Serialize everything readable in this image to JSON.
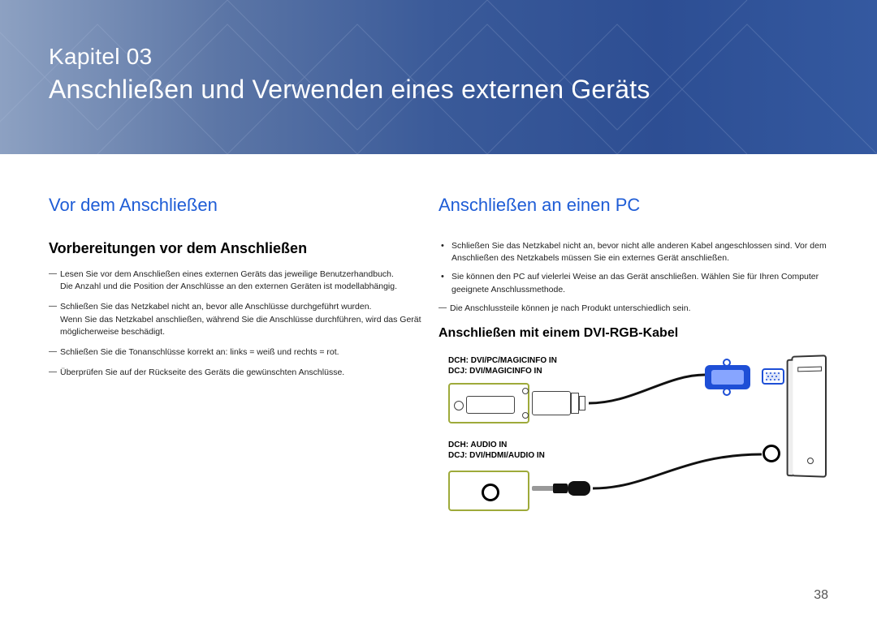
{
  "hero": {
    "chapter": "Kapitel 03",
    "title": "Anschließen und Verwenden eines externen Geräts"
  },
  "left": {
    "heading": "Vor dem Anschließen",
    "subheading": "Vorbereitungen vor dem Anschließen",
    "items": [
      {
        "line1": "Lesen Sie vor dem Anschließen eines externen Geräts das jeweilige Benutzerhandbuch.",
        "line2": "Die Anzahl und die Position der Anschlüsse an den externen Geräten ist modellabhängig."
      },
      {
        "line1": "Schließen Sie das Netzkabel nicht an, bevor alle Anschlüsse durchgeführt wurden.",
        "line2": "Wenn Sie das Netzkabel anschließen, während Sie die Anschlüsse durchführen, wird das Gerät möglicherweise beschädigt."
      },
      {
        "line1": "Schließen Sie die Tonanschlüsse korrekt an: links = weiß und rechts = rot."
      },
      {
        "line1": "Überprüfen Sie auf der Rückseite des Geräts die gewünschten Anschlüsse."
      }
    ]
  },
  "right": {
    "heading": "Anschließen an einen PC",
    "bullets": [
      {
        "line1": "Schließen Sie das Netzkabel nicht an, bevor nicht alle anderen Kabel angeschlossen sind.",
        "line2": "Vor dem Anschließen des Netzkabels müssen Sie ein externes Gerät anschließen."
      },
      {
        "line1": "Sie können den PC auf vielerlei Weise an das Gerät anschließen.",
        "line2": "Wählen Sie für Ihren Computer geeignete Anschlussmethode."
      }
    ],
    "notes": [
      {
        "line1": "Die Anschlussteile können je nach Produkt unterschiedlich sein."
      }
    ],
    "subheading": "Anschließen mit einem DVI-RGB-Kabel",
    "labels": {
      "dvi1": "DCH: DVI/PC/MAGICINFO IN",
      "dvi2": "DCJ: DVI/MAGICINFO IN",
      "audio1": "DCH: AUDIO IN",
      "audio2": "DCJ: DVI/HDMI/AUDIO IN"
    }
  },
  "page_number": "38"
}
